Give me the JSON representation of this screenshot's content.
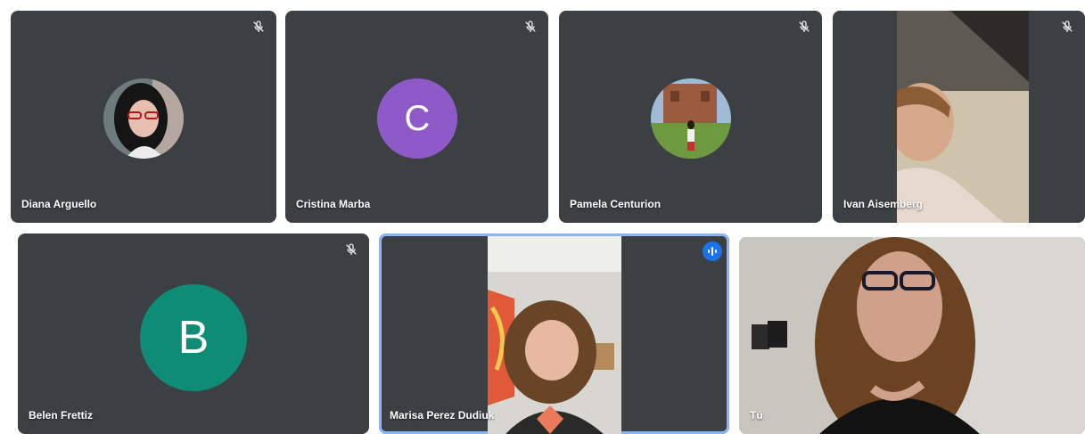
{
  "participants": [
    {
      "name": "Diana Arguello",
      "muted": true
    },
    {
      "name": "Cristina Marba",
      "muted": true,
      "initial": "C",
      "avatar_color": "#8e5ac7"
    },
    {
      "name": "Pamela Centurion",
      "muted": true
    },
    {
      "name": "Ivan Aisemberg",
      "muted": true
    },
    {
      "name": "Belen Frettiz",
      "muted": true,
      "initial": "B",
      "avatar_color": "#0e8c76"
    },
    {
      "name": "Marisa Perez Dudiuk",
      "muted": false,
      "speaking": true
    },
    {
      "name": "Tú",
      "muted": false
    }
  ],
  "colors": {
    "tile_bg": "#3c4043",
    "speaking_border": "#8ab4f8",
    "speaking_badge": "#1a73e8"
  },
  "icons": [
    "microphone-off-icon",
    "audio-level-icon"
  ]
}
